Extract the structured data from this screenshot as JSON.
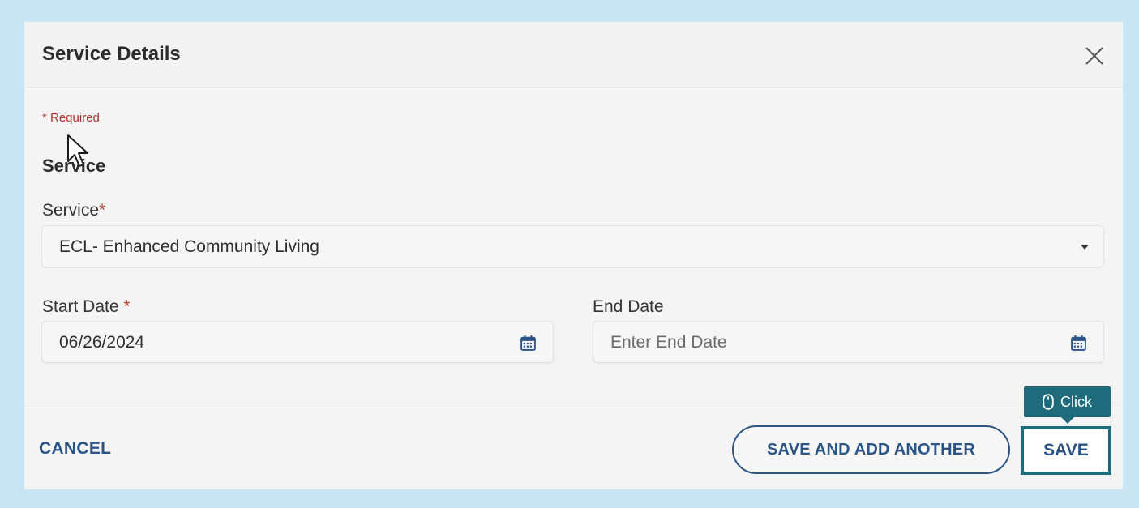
{
  "modal": {
    "title": "Service Details",
    "required_note": "* Required",
    "section_title": "Service"
  },
  "fields": {
    "service": {
      "label": "Service",
      "required_mark": "*",
      "value": "ECL- Enhanced Community Living"
    },
    "start_date": {
      "label": "Start Date",
      "required_mark": "*",
      "value": "06/26/2024"
    },
    "end_date": {
      "label": "End Date",
      "placeholder": "Enter End Date"
    }
  },
  "footer": {
    "cancel_label": "CANCEL",
    "save_and_add_label": "SAVE AND ADD ANOTHER",
    "save_label": "SAVE"
  },
  "tooltip": {
    "label": "Click",
    "icon": "mouse-icon"
  },
  "icons": {
    "close": "close-icon",
    "dropdown": "chevron-down-icon",
    "calendar": "calendar-icon",
    "cursor": "mouse-pointer-icon"
  },
  "colors": {
    "background": "#c9e4f2",
    "primary": "#2c5587",
    "required": "#b0342c",
    "highlight": "#1f6b7c",
    "calendar_icon": "#2c5587"
  }
}
